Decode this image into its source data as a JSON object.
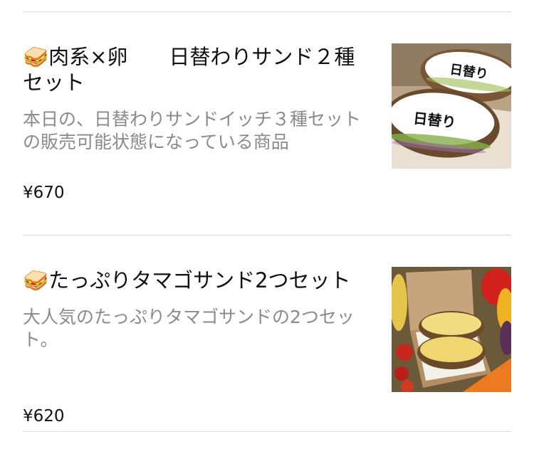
{
  "items": [
    {
      "icon": "sandwich-icon",
      "emoji": "🥪",
      "title": "肉系×卵　　日替わりサンド２種セット",
      "description": "本日の、日替わりサンドイッチ３種セットの販売可能状態になっている商品",
      "price": "¥670",
      "image_label_1": "日替り",
      "image_label_2": "日替り"
    },
    {
      "icon": "sandwich-icon",
      "emoji": "🥪",
      "title": "たっぷりタマゴサンド2つセット",
      "description": "大人気のたっぷりタマゴサンドの2つセット。",
      "price": "¥620"
    }
  ],
  "colors": {
    "divider": "#dcdcdc",
    "description": "#8a8a8a",
    "title": "#111111"
  }
}
